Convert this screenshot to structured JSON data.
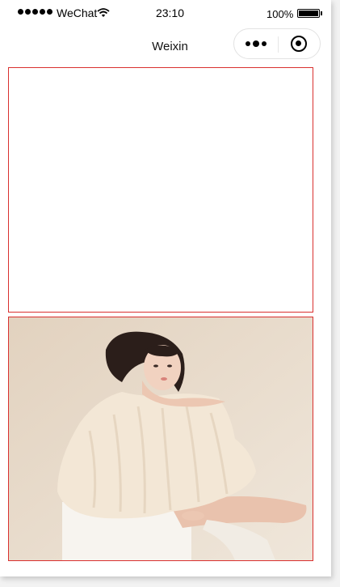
{
  "status_bar": {
    "carrier": "WeChat",
    "time": "23:10",
    "battery": "100%"
  },
  "nav": {
    "title": "Weixin"
  },
  "icons": {
    "signal": "signal-dots-icon",
    "wifi": "wifi-icon",
    "battery": "battery-icon",
    "more": "more-dots-icon",
    "close": "record-close-icon"
  },
  "colors": {
    "box_border": "#d9302f",
    "photo_bg": "#e8dccb",
    "sweater": "#f3e7d6"
  }
}
